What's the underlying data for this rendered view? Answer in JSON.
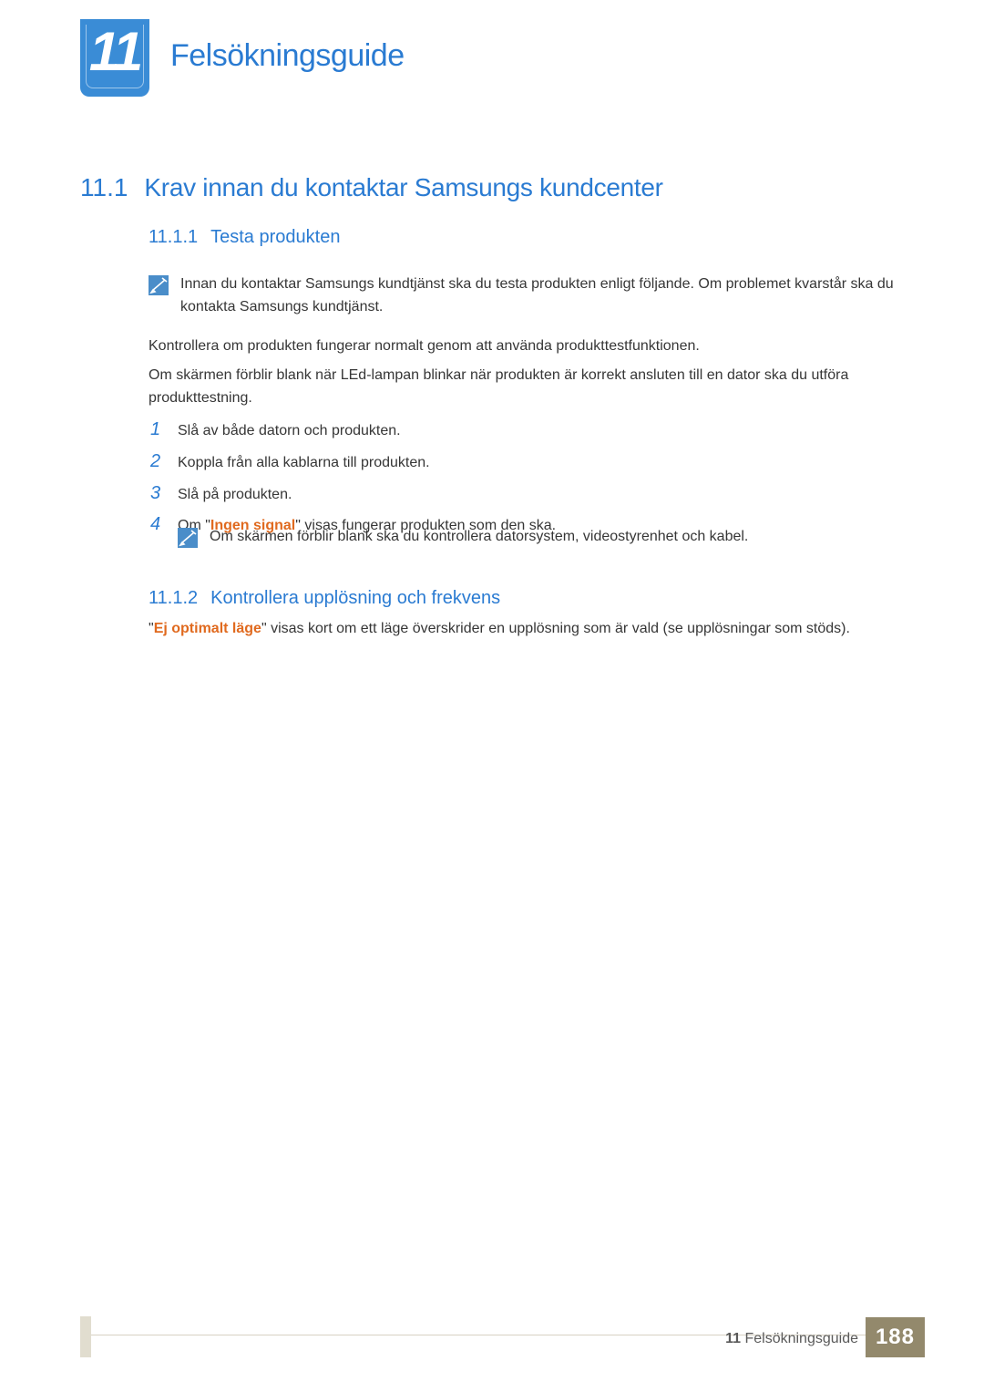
{
  "chapter": {
    "number": "11",
    "title": "Felsökningsguide"
  },
  "section": {
    "number": "11.1",
    "title": "Krav innan du kontaktar Samsungs kundcenter"
  },
  "subsection1": {
    "number": "11.1.1",
    "title": "Testa produkten",
    "note": "Innan du kontaktar Samsungs kundtjänst ska du testa produkten enligt följande. Om problemet kvarstår ska du kontakta Samsungs kundtjänst.",
    "para1": "Kontrollera om produkten fungerar normalt genom att använda produkttestfunktionen.",
    "para2": "Om skärmen förblir blank när LEd-lampan blinkar när produkten är korrekt ansluten till en dator ska du utföra produkttestning.",
    "steps": [
      "Slå av både datorn och produkten.",
      "Koppla från alla kablarna till produkten.",
      "Slå på produkten."
    ],
    "step4_prefix": "Om ",
    "step4_quote": "Ingen signal",
    "step4_suffix": " visas fungerar produkten som den ska.",
    "note2": "Om skärmen förblir blank ska du kontrollera datorsystem, videostyrenhet och kabel."
  },
  "subsection2": {
    "number": "11.1.2",
    "title": "Kontrollera upplösning och frekvens",
    "para_quote": "Ej optimalt läge",
    "para_suffix": " visas kort om ett läge överskrider en upplösning som är vald (se upplösningar som stöds)."
  },
  "footer": {
    "chapter_num": "11",
    "chapter_title": "Felsökningsguide",
    "page_number": "188"
  }
}
